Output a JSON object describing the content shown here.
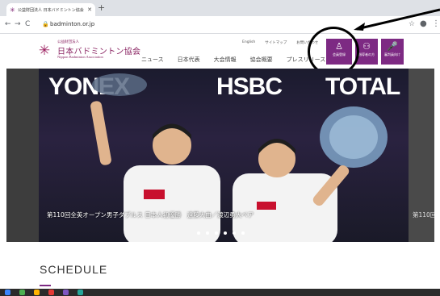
{
  "browser": {
    "tab_title": "公益財団法人 日本バドミントン協会",
    "url": "badminton.or.jp"
  },
  "site": {
    "logo_sub": "公益財団法人",
    "logo_name": "日本バドミントン協会",
    "logo_en": "Nippon Badminton Association",
    "util_links": [
      "English",
      "サイトマップ",
      "お問い合わせ"
    ],
    "nav": [
      "ニュース",
      "日本代表",
      "大会情報",
      "協会概要",
      "プレスリリース"
    ],
    "buttons": [
      {
        "label": "会員登録",
        "icon": "person-icon"
      },
      {
        "label": "指導者の方",
        "icon": "group-icon"
      },
      {
        "label": "審判員向け",
        "icon": "whistle-icon"
      }
    ]
  },
  "hero": {
    "sponsors": [
      "YONEX",
      "HSBC",
      "TOTAL"
    ],
    "caption": "第110回全英オープン男子ダブルス 日本人初優勝　遠藤大由／渡辺勇大ペア",
    "caption_next": "第110回",
    "slide_count": 6,
    "active_slide": 5
  },
  "schedule": {
    "title": "SCHEDULE"
  },
  "colors": {
    "brand": "#7d2a83",
    "logo": "#8a2462"
  }
}
